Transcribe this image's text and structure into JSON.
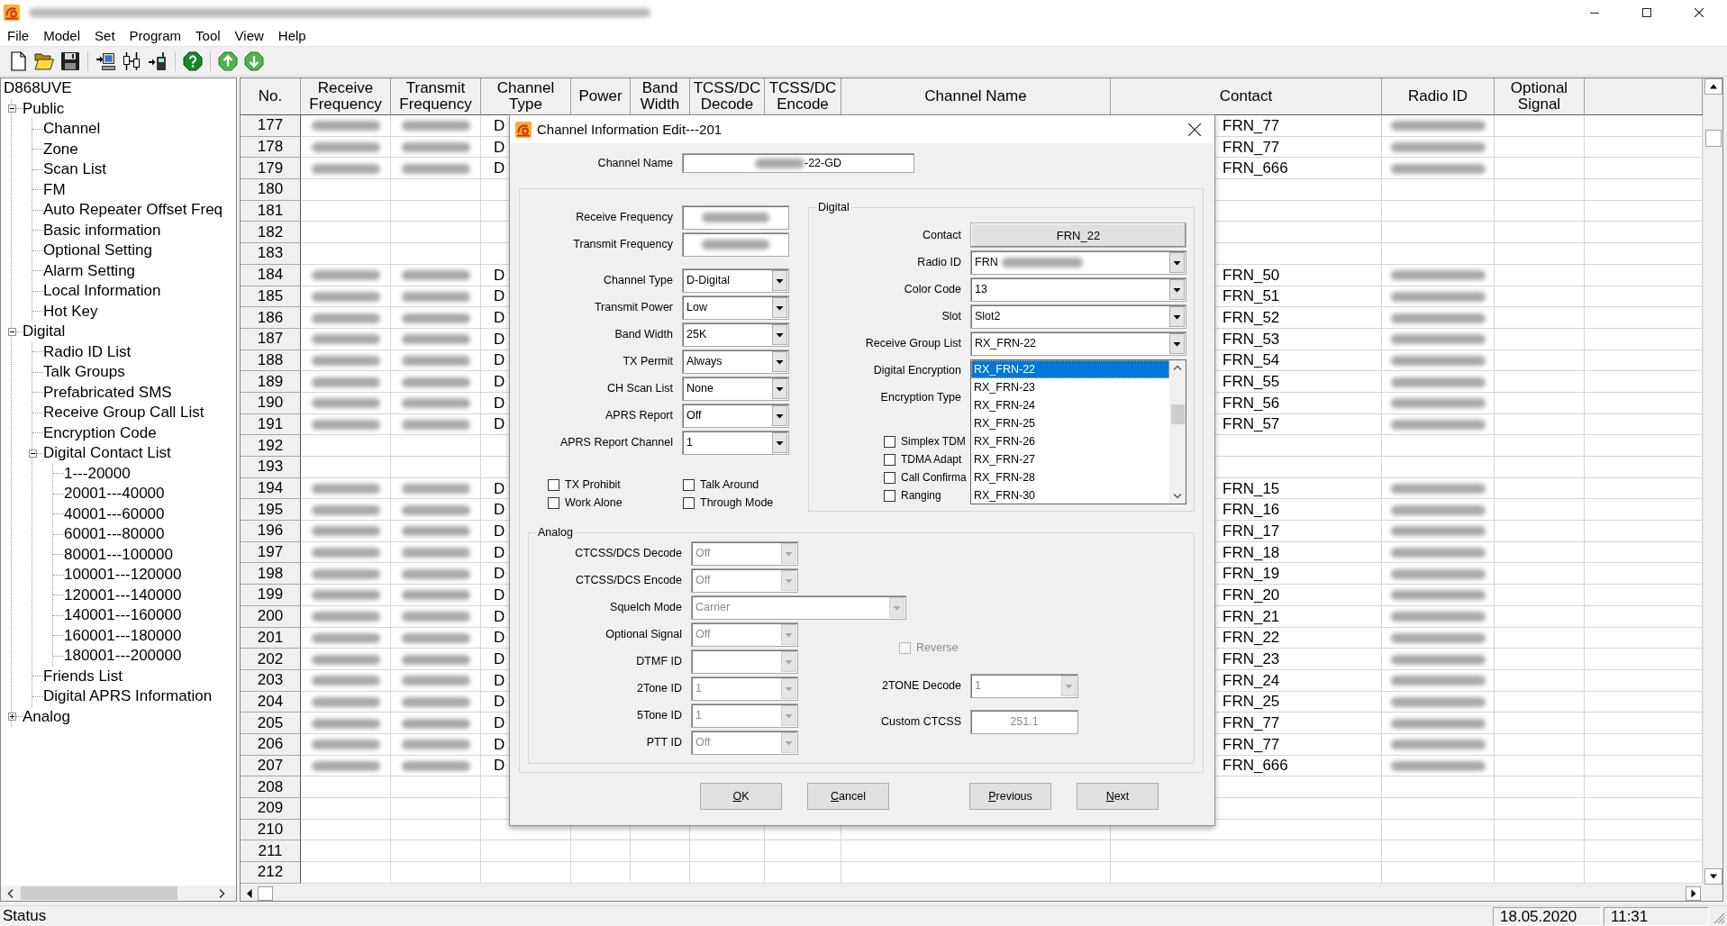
{
  "window": {
    "title_blurred": true
  },
  "menu": [
    "File",
    "Model",
    "Set",
    "Program",
    "Tool",
    "View",
    "Help"
  ],
  "tree": {
    "label": "D868UVE",
    "children": [
      {
        "label": "Public",
        "expanded": true,
        "children": [
          {
            "label": "Channel"
          },
          {
            "label": "Zone"
          },
          {
            "label": "Scan List"
          },
          {
            "label": "FM"
          },
          {
            "label": "Auto Repeater Offset Freq"
          },
          {
            "label": "Basic information"
          },
          {
            "label": "Optional Setting"
          },
          {
            "label": "Alarm Setting"
          },
          {
            "label": "Local Information"
          },
          {
            "label": "Hot Key"
          }
        ]
      },
      {
        "label": "Digital",
        "expanded": true,
        "children": [
          {
            "label": "Radio ID List"
          },
          {
            "label": "Talk Groups"
          },
          {
            "label": "Prefabricated SMS"
          },
          {
            "label": "Receive Group Call List"
          },
          {
            "label": "Encryption Code"
          },
          {
            "label": "Digital Contact List",
            "expanded": true,
            "children": [
              {
                "label": "1---20000"
              },
              {
                "label": "20001---40000"
              },
              {
                "label": "40001---60000"
              },
              {
                "label": "60001---80000"
              },
              {
                "label": "80001---100000"
              },
              {
                "label": "100001---120000"
              },
              {
                "label": "120001---140000"
              },
              {
                "label": "140001---160000"
              },
              {
                "label": "160001---180000"
              },
              {
                "label": "180001---200000"
              }
            ]
          },
          {
            "label": "Friends List"
          },
          {
            "label": "Digital APRS Information"
          }
        ]
      },
      {
        "label": "Analog",
        "expanded": false
      }
    ]
  },
  "table": {
    "columns": [
      "No.",
      "Receive Frequency",
      "Transmit Frequency",
      "Channel Type",
      "Power",
      "Band Width",
      "TCSS/DC Decode",
      "TCSS/DC Encode",
      "Channel Name",
      "Contact",
      "Radio ID",
      "Optional Signal"
    ],
    "rows": [
      {
        "no": "177",
        "blurred": true,
        "channel_type": "D",
        "contact": "FRN_77"
      },
      {
        "no": "178",
        "blurred": true,
        "channel_type": "D",
        "contact": "FRN_77"
      },
      {
        "no": "179",
        "blurred": true,
        "channel_type": "D",
        "contact": "FRN_666"
      },
      {
        "no": "180",
        "blurred": false
      },
      {
        "no": "181",
        "blurred": false
      },
      {
        "no": "182",
        "blurred": false
      },
      {
        "no": "183",
        "blurred": false
      },
      {
        "no": "184",
        "blurred": true,
        "channel_type": "D",
        "contact": "FRN_50"
      },
      {
        "no": "185",
        "blurred": true,
        "channel_type": "D",
        "contact": "FRN_51"
      },
      {
        "no": "186",
        "blurred": true,
        "channel_type": "D",
        "contact": "FRN_52"
      },
      {
        "no": "187",
        "blurred": true,
        "channel_type": "D",
        "contact": "FRN_53"
      },
      {
        "no": "188",
        "blurred": true,
        "channel_type": "D",
        "contact": "FRN_54"
      },
      {
        "no": "189",
        "blurred": true,
        "channel_type": "D",
        "contact": "FRN_55"
      },
      {
        "no": "190",
        "blurred": true,
        "channel_type": "D",
        "contact": "FRN_56"
      },
      {
        "no": "191",
        "blurred": true,
        "channel_type": "D",
        "contact": "FRN_57"
      },
      {
        "no": "192",
        "blurred": false
      },
      {
        "no": "193",
        "blurred": false
      },
      {
        "no": "194",
        "blurred": true,
        "channel_type": "D",
        "contact": "FRN_15"
      },
      {
        "no": "195",
        "blurred": true,
        "channel_type": "D",
        "contact": "FRN_16"
      },
      {
        "no": "196",
        "blurred": true,
        "channel_type": "D",
        "contact": "FRN_17"
      },
      {
        "no": "197",
        "blurred": true,
        "channel_type": "D",
        "contact": "FRN_18"
      },
      {
        "no": "198",
        "blurred": true,
        "channel_type": "D",
        "contact": "FRN_19"
      },
      {
        "no": "199",
        "blurred": true,
        "channel_type": "D",
        "contact": "FRN_20"
      },
      {
        "no": "200",
        "blurred": true,
        "channel_type": "D",
        "contact": "FRN_21"
      },
      {
        "no": "201",
        "blurred": true,
        "channel_type": "D",
        "contact": "FRN_22"
      },
      {
        "no": "202",
        "blurred": true,
        "channel_type": "D",
        "contact": "FRN_23"
      },
      {
        "no": "203",
        "blurred": true,
        "channel_type": "D",
        "contact": "FRN_24"
      },
      {
        "no": "204",
        "blurred": true,
        "channel_type": "D",
        "contact": "FRN_25"
      },
      {
        "no": "205",
        "blurred": true,
        "channel_type": "D",
        "contact": "FRN_77"
      },
      {
        "no": "206",
        "blurred": true,
        "channel_type": "D",
        "contact": "FRN_77"
      },
      {
        "no": "207",
        "blurred": true,
        "channel_type": "D",
        "contact": "FRN_666"
      },
      {
        "no": "208",
        "blurred": false
      },
      {
        "no": "209",
        "blurred": false
      },
      {
        "no": "210",
        "blurred": false
      },
      {
        "no": "211",
        "blurred": false
      },
      {
        "no": "212",
        "blurred": false
      }
    ]
  },
  "dialog": {
    "title": "Channel Information Edit---201",
    "channel_name": {
      "label": "Channel Name",
      "value": "-22-GD",
      "blurred": true
    },
    "fields": [
      {
        "label": "Receive Frequency",
        "kind": "text",
        "blurred": true,
        "disabled": false
      },
      {
        "label": "Transmit Frequency",
        "kind": "text",
        "blurred": true,
        "disabled": false
      },
      {
        "label": "Channel Type",
        "kind": "combo",
        "value": "D-Digital",
        "disabled": false
      },
      {
        "label": "Transmit Power",
        "kind": "combo",
        "value": "Low",
        "disabled": false
      },
      {
        "label": "Band Width",
        "kind": "combo",
        "value": "25K",
        "disabled": false
      },
      {
        "label": "TX Permit",
        "kind": "combo",
        "value": "Always",
        "disabled": false
      },
      {
        "label": "CH Scan List",
        "kind": "combo",
        "value": "None",
        "disabled": false
      },
      {
        "label": "APRS Report",
        "kind": "combo",
        "value": "Off",
        "disabled": false
      },
      {
        "label": "APRS Report Channel",
        "kind": "combo",
        "value": "1",
        "disabled": false
      }
    ],
    "checkboxes": [
      {
        "label": "TX Prohibit",
        "checked": false
      },
      {
        "label": "Talk Around",
        "checked": false
      },
      {
        "label": "Work Alone",
        "checked": false
      },
      {
        "label": "Through Mode",
        "checked": false
      }
    ],
    "digital": {
      "title": "Digital",
      "fields": [
        {
          "label": "Contact",
          "kind": "button",
          "value": "FRN_22",
          "disabled": false
        },
        {
          "label": "Radio ID",
          "kind": "combo",
          "value": "FRN",
          "blurred": true,
          "disabled": false
        },
        {
          "label": "Color Code",
          "kind": "combo",
          "value": "13",
          "disabled": false
        },
        {
          "label": "Slot",
          "kind": "combo",
          "value": "Slot2",
          "disabled": false
        },
        {
          "label": "Receive Group List",
          "kind": "combo",
          "value": "RX_FRN-22",
          "disabled": false,
          "open": true,
          "options": [
            {
              "label": "RX_FRN-22",
              "selected": true
            },
            {
              "label": "RX_FRN-23",
              "selected": false
            },
            {
              "label": "RX_FRN-24",
              "selected": false
            },
            {
              "label": "RX_FRN-25",
              "selected": false
            },
            {
              "label": "RX_FRN-26",
              "selected": false
            },
            {
              "label": "RX_FRN-27",
              "selected": false
            },
            {
              "label": "RX_FRN-28",
              "selected": false
            },
            {
              "label": "RX_FRN-30",
              "selected": false
            }
          ]
        },
        {
          "label": "Digital Encryption",
          "kind": "label"
        },
        {
          "label": "Encryption Type",
          "kind": "label"
        }
      ],
      "checkboxes": [
        {
          "label": "Simplex TDM",
          "checked": false
        },
        {
          "label": "TDMA Adapt",
          "checked": false
        },
        {
          "label": "Call Confirma",
          "checked": false
        },
        {
          "label": "Ranging",
          "checked": false
        }
      ]
    },
    "analog": {
      "title": "Analog",
      "fields": [
        {
          "label": "CTCSS/DCS Decode",
          "kind": "combo",
          "value": "Off",
          "disabled": true
        },
        {
          "label": "CTCSS/DCS Encode",
          "kind": "combo",
          "value": "Off",
          "disabled": true
        },
        {
          "label": "Squelch Mode",
          "kind": "wide_combo",
          "value": "Carrier",
          "disabled": true
        },
        {
          "label": "Optional Signal",
          "kind": "combo",
          "value": "Off",
          "disabled": true
        },
        {
          "label": "DTMF ID",
          "kind": "combo",
          "disabled": true
        },
        {
          "label": "2Tone ID",
          "kind": "combo",
          "value": "1",
          "disabled": true
        },
        {
          "label": "5Tone ID",
          "kind": "combo",
          "value": "1",
          "disabled": true
        },
        {
          "label": "PTT ID",
          "kind": "combo",
          "value": "Off",
          "disabled": true
        }
      ],
      "reverse": {
        "label": "Reverse",
        "checked": false,
        "disabled": true
      },
      "side_fields": [
        {
          "label": "2TONE Decode",
          "kind": "combo",
          "value": "1",
          "disabled": true
        },
        {
          "label": "Custom CTCSS",
          "kind": "text",
          "value": "251.1",
          "disabled": true
        }
      ]
    },
    "buttons": [
      "OK",
      "Cancel",
      "Previous",
      "Next"
    ]
  },
  "status_bar": {
    "text": "Status",
    "date": "18.05.2020",
    "time": "11:31"
  }
}
